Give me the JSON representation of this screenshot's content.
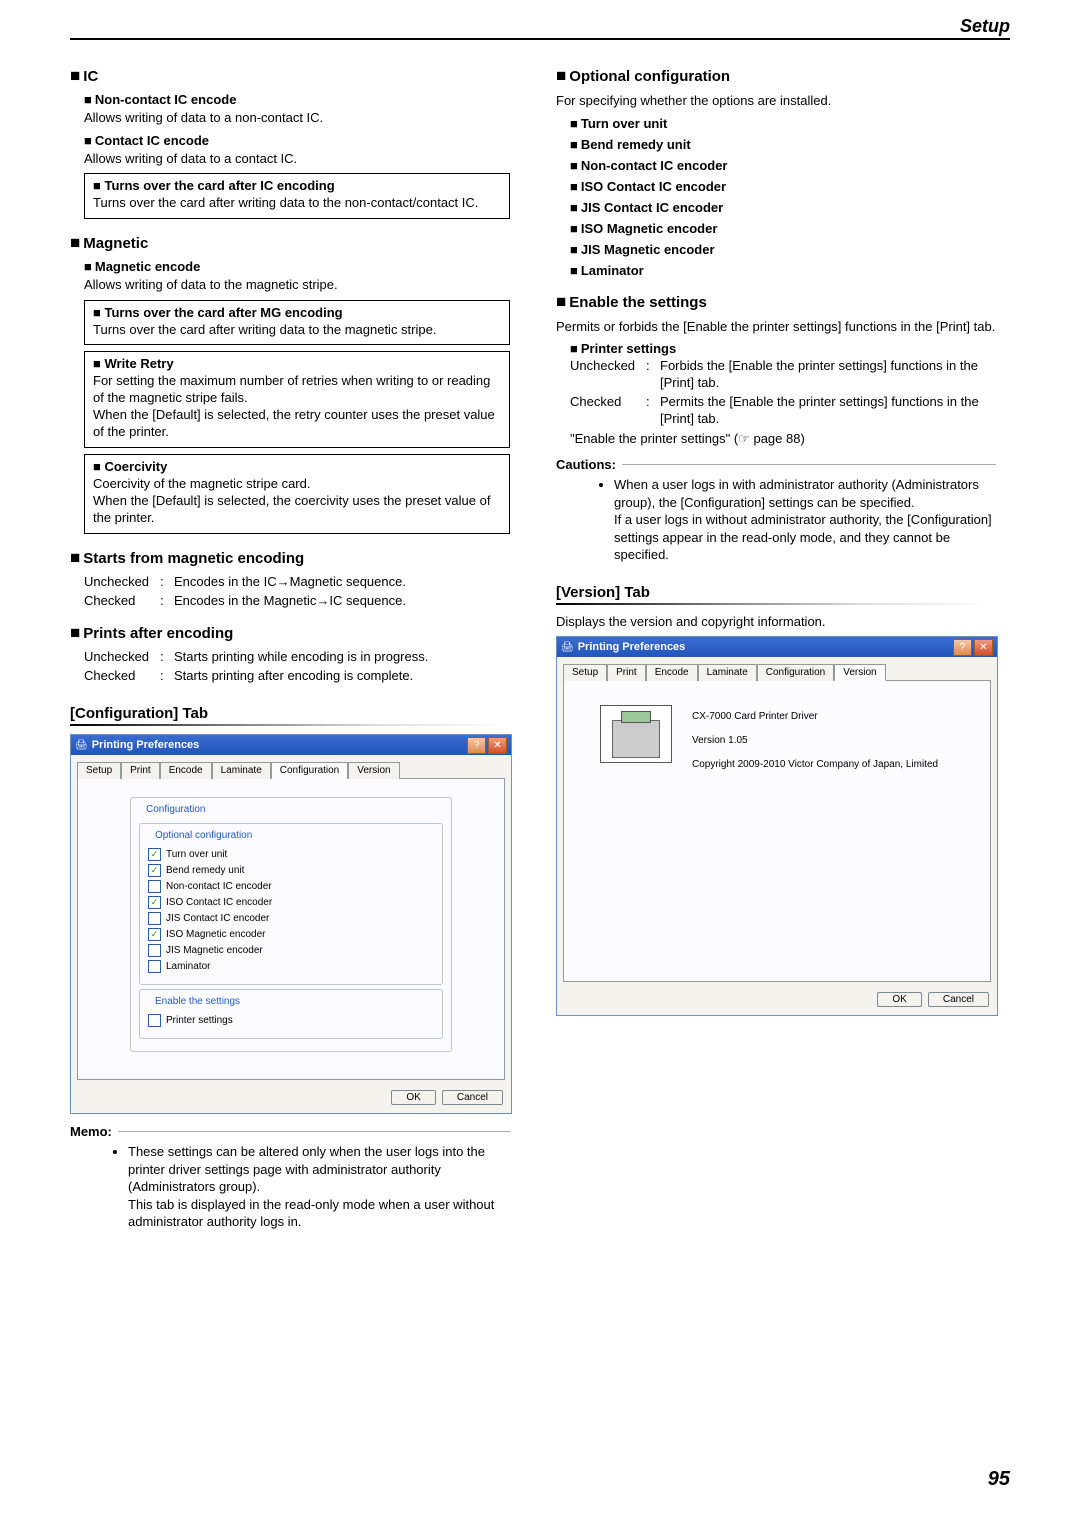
{
  "page": {
    "header": "Setup",
    "number": "95"
  },
  "left": {
    "ic": {
      "title": "IC",
      "noncontact": {
        "title": "Non-contact IC encode",
        "desc": "Allows writing of data to a non-contact IC."
      },
      "contact": {
        "title": "Contact IC encode",
        "desc": "Allows writing of data to a contact IC."
      },
      "turnover": {
        "title": "Turns over the card after IC encoding",
        "desc": "Turns over the card after writing data to the non-contact/contact IC."
      }
    },
    "magnetic": {
      "title": "Magnetic",
      "encode": {
        "title": "Magnetic encode",
        "desc": "Allows writing of data to the magnetic stripe."
      },
      "turnover": {
        "title": "Turns over the card after MG encoding",
        "desc": "Turns over the card after writing data to the magnetic stripe."
      },
      "write_retry": {
        "title": "Write Retry",
        "desc": "For setting the maximum number of retries when writing to or reading of the magnetic stripe fails.\nWhen the [Default] is selected, the retry counter uses the preset value of the printer."
      },
      "coercivity": {
        "title": "Coercivity",
        "desc": "Coercivity of the magnetic stripe card.\nWhen the [Default] is selected, the coercivity uses the preset value of the printer."
      }
    },
    "starts_from": {
      "title": "Starts from magnetic encoding",
      "unchecked_label": "Unchecked",
      "unchecked": "Encodes in the IC→Magnetic sequence.",
      "checked_label": "Checked",
      "checked": "Encodes in the Magnetic→IC sequence."
    },
    "prints_after": {
      "title": "Prints after encoding",
      "unchecked_label": "Unchecked",
      "unchecked": "Starts printing while encoding is in progress.",
      "checked_label": "Checked",
      "checked": "Starts printing after encoding is complete."
    },
    "config_tab": {
      "title": "[Configuration] Tab"
    },
    "dialog": {
      "title": "Printing Preferences",
      "tabs": [
        "Setup",
        "Print",
        "Encode",
        "Laminate",
        "Configuration",
        "Version"
      ],
      "active_tab": "Configuration",
      "group": "Configuration",
      "opt_group": "Optional configuration",
      "items": [
        {
          "label": "Turn over unit",
          "checked": true
        },
        {
          "label": "Bend remedy unit",
          "checked": true
        },
        {
          "label": "Non-contact IC encoder",
          "checked": false
        },
        {
          "label": "ISO Contact IC encoder",
          "checked": true
        },
        {
          "label": "JIS Contact IC encoder",
          "checked": false
        },
        {
          "label": "ISO Magnetic encoder",
          "checked": true
        },
        {
          "label": "JIS Magnetic encoder",
          "checked": false
        },
        {
          "label": "Laminator",
          "checked": false
        }
      ],
      "enable_group": "Enable the settings",
      "enable_item": {
        "label": "Printer settings",
        "checked": false
      },
      "ok": "OK",
      "cancel": "Cancel"
    },
    "memo": {
      "title": "Memo:",
      "body": "These settings can be altered only when the user logs into the printer driver settings page with administrator authority (Administrators group).\nThis tab is displayed in the read-only mode when a user without administrator authority logs in."
    }
  },
  "right": {
    "optional": {
      "title": "Optional configuration",
      "desc": "For specifying whether the options are installed.",
      "items": [
        "Turn over unit",
        "Bend remedy unit",
        "Non-contact IC encoder",
        "ISO Contact IC encoder",
        "JIS Contact IC encoder",
        "ISO Magnetic encoder",
        "JIS Magnetic encoder",
        "Laminator"
      ]
    },
    "enable": {
      "title": "Enable the settings",
      "desc": "Permits or forbids the [Enable the printer settings] functions in the [Print] tab.",
      "sub_title": "Printer settings",
      "unchecked_label": "Unchecked",
      "unchecked": "Forbids the [Enable the printer settings] functions in the [Print] tab.",
      "checked_label": "Checked",
      "checked": "Permits the [Enable the printer settings] functions in the [Print] tab.",
      "ref": "\"Enable the printer settings\" (☞ page 88)"
    },
    "cautions": {
      "title": "Cautions:",
      "body": "When a user logs in with administrator authority (Administrators group), the [Configuration] settings can be specified.\nIf a user logs in without administrator authority, the [Configuration] settings appear in the read-only mode, and they cannot be specified."
    },
    "version_tab": {
      "title": "[Version] Tab",
      "desc": "Displays the version and copyright information."
    },
    "version_dialog": {
      "title": "Printing Preferences",
      "tabs": [
        "Setup",
        "Print",
        "Encode",
        "Laminate",
        "Configuration",
        "Version"
      ],
      "active_tab": "Version",
      "driver": "CX-7000 Card Printer Driver",
      "version": "Version 1.05",
      "copyright": "Copyright 2009-2010 Victor Company of Japan, Limited",
      "ok": "OK",
      "cancel": "Cancel"
    }
  }
}
